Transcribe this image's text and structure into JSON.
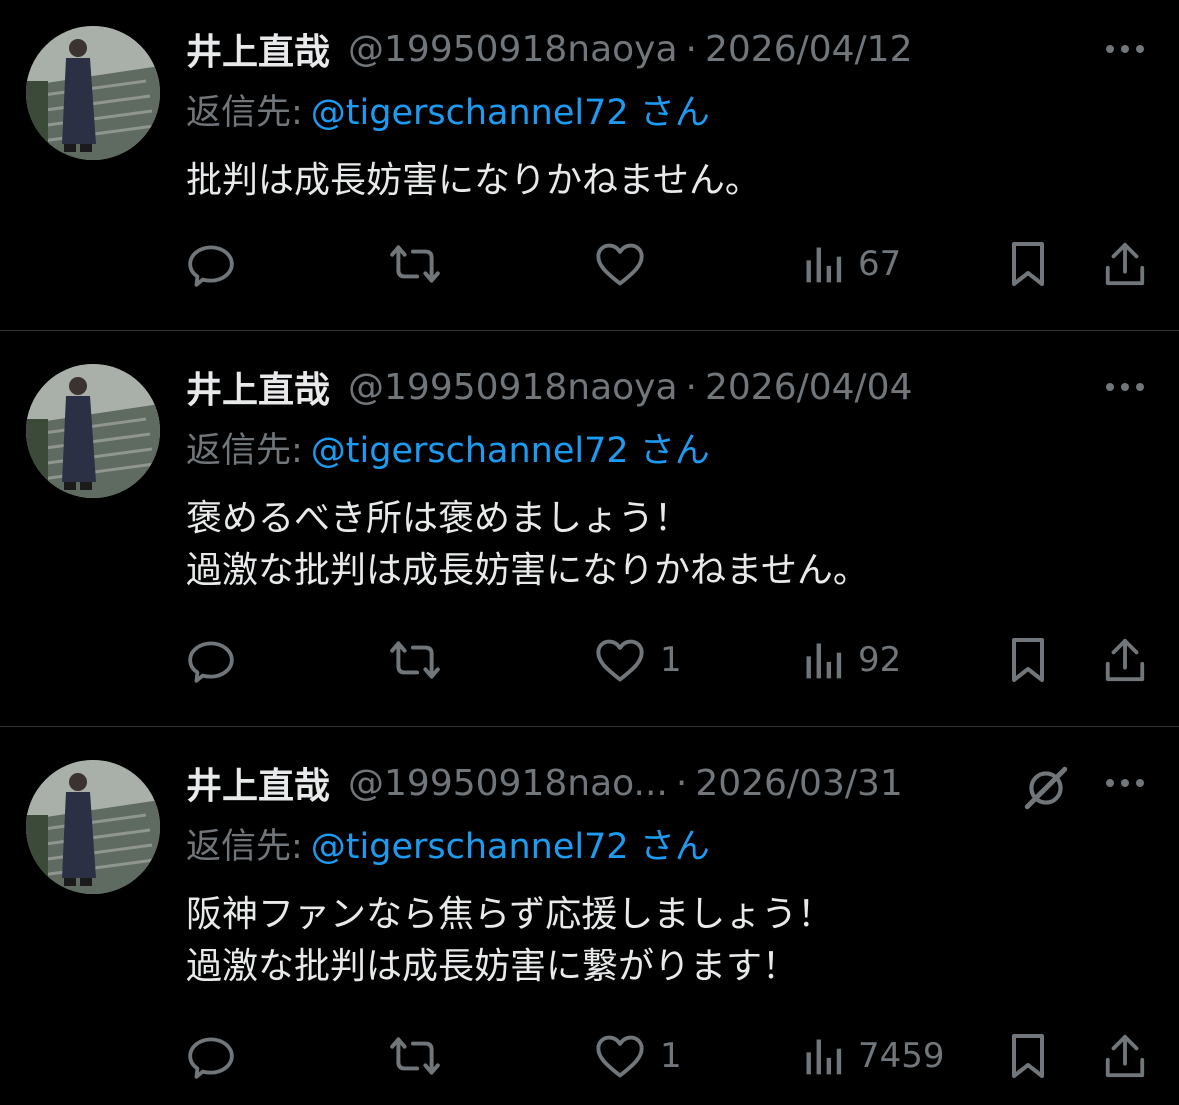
{
  "icons": {
    "reply": "speech-bubble-icon",
    "retweet": "repost-arrows-icon",
    "like": "heart-icon",
    "views": "bar-chart-icon",
    "bookmark": "bookmark-icon",
    "share": "share-upload-icon",
    "more": "more-dots-icon",
    "grok": "grok-slash-icon"
  },
  "colors": {
    "background": "#000000",
    "text": "#e7e9ea",
    "muted": "#71767b",
    "link": "#1d9bf0",
    "divider": "#2f3336"
  },
  "tweets": [
    {
      "name": "井上直哉",
      "handle": "@19950918naoya",
      "separator": "·",
      "date": "2026/04/12",
      "reply_label": "返信先:",
      "reply_target": "@tigerschannel72 さん",
      "lines": [
        "批判は成長妨害になりかねません。"
      ],
      "likes": "",
      "views": "67"
    },
    {
      "name": "井上直哉",
      "handle": "@19950918naoya",
      "separator": "·",
      "date": "2026/04/04",
      "reply_label": "返信先:",
      "reply_target": "@tigerschannel72 さん",
      "lines": [
        "褒めるべき所は褒めましょう！",
        "過激な批判は成長妨害になりかねません。"
      ],
      "likes": "1",
      "views": "92"
    },
    {
      "name": "井上直哉",
      "handle": "@19950918nao...",
      "separator": "·",
      "date": "2026/03/31",
      "reply_label": "返信先:",
      "reply_target": "@tigerschannel72 さん",
      "lines": [
        "阪神ファンなら焦らず応援しましょう！",
        "過激な批判は成長妨害に繋がります！"
      ],
      "likes": "1",
      "views": "7459"
    }
  ]
}
